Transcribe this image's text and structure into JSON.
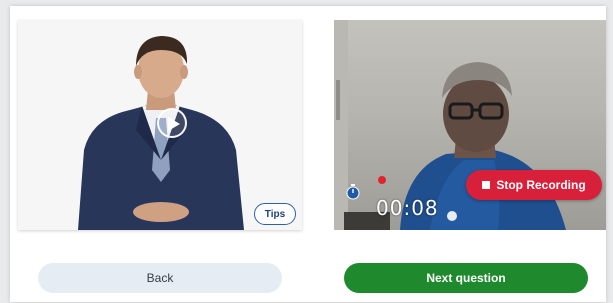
{
  "interviewer_panel": {
    "tips_label": "Tips"
  },
  "webcam_panel": {
    "timer": "00:08",
    "stop_recording_label": "Stop Recording",
    "recording_indicator_color": "#e0242f"
  },
  "footer": {
    "back_label": "Back",
    "next_label": "Next question"
  },
  "colors": {
    "accent_green": "#1f8a2d",
    "stop_red": "#d8203a",
    "tips_border_blue": "#2f5fae"
  },
  "icons": [
    "play-icon",
    "stopwatch-icon",
    "stop-icon",
    "record-dot-icon"
  ]
}
